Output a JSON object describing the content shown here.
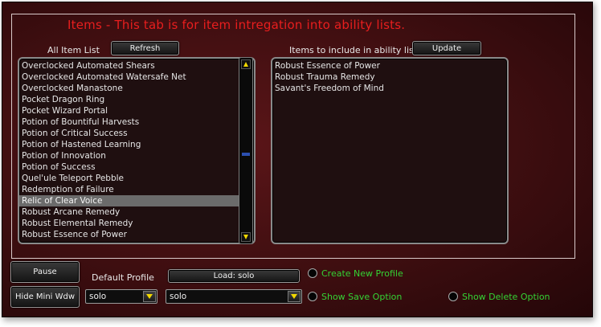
{
  "title": "Items - This tab is for item intregation into ability lists.",
  "all_items": {
    "label": "All Item List",
    "refresh_label": "Refresh",
    "items": [
      "Overclocked Automated Shears",
      "Overclocked Automated Watersafe Net",
      "Overclocked Manastone",
      "Pocket Dragon Ring",
      "Pocket Wizard Portal",
      "Potion of Bountiful Harvests",
      "Potion of Critical Success",
      "Potion of Hastened Learning",
      "Potion of Innovation",
      "Potion of Success",
      "Quel'ule Teleport Pebble",
      "Redemption of Failure",
      "Relic of Clear Voice",
      "Robust Arcane Remedy",
      "Robust Elemental Remedy",
      "Robust Essence of Power"
    ],
    "selected_item": "Relic of Clear Voice"
  },
  "included": {
    "label": "Items to include in ability lists",
    "update_label": "Update",
    "items": [
      "Robust Essence of Power",
      "Robust Trauma Remedy",
      "Savant's Freedom of Mind"
    ]
  },
  "bottom": {
    "pause_label": "Pause",
    "hide_label": "Hide Mini Wdw",
    "default_profile_label": "Default Profile",
    "load_label": "Load: solo",
    "profile_select_value": "solo",
    "load_select_value": "solo",
    "create_new_profile": "Create New Profile",
    "show_save_option": "Show Save Option",
    "show_delete_option": "Show Delete Option"
  },
  "colors": {
    "title": "#e81e1e",
    "option_text": "#34d334",
    "background": "#3e0e10"
  }
}
